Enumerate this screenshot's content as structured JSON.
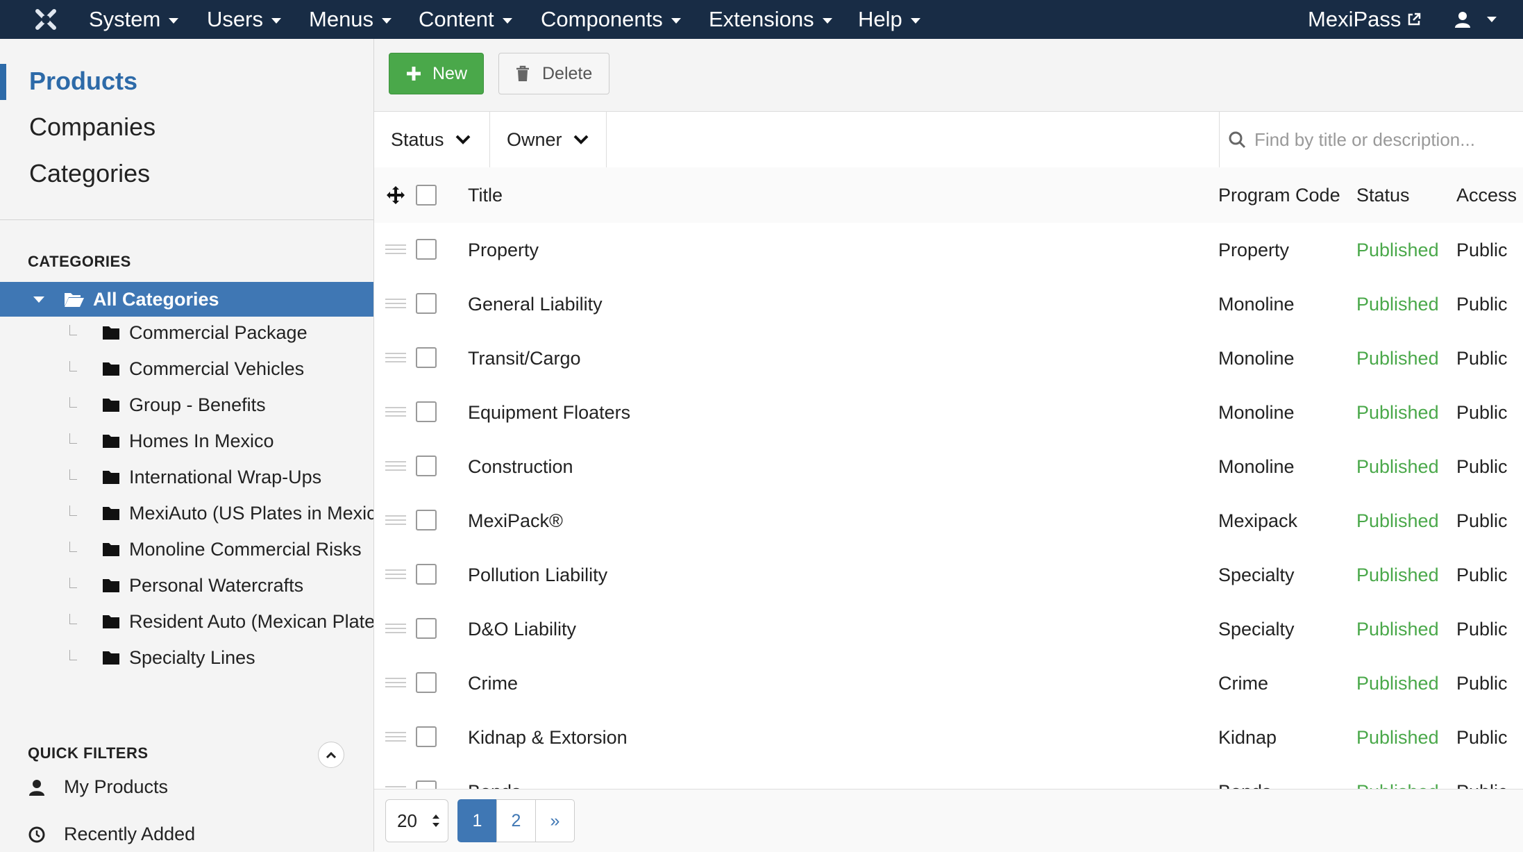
{
  "topbar": {
    "menus": [
      "System",
      "Users",
      "Menus",
      "Content",
      "Components",
      "Extensions",
      "Help"
    ],
    "site_link": "MexiPass",
    "icons": {
      "logo": "joomla-logo-icon",
      "external": "external-link-icon",
      "user": "user-icon"
    }
  },
  "sidebar": {
    "nav": [
      "Products",
      "Companies",
      "Categories"
    ],
    "categories_title": "CATEGORIES",
    "all_categories": "All Categories",
    "categories": [
      "Commercial Package",
      "Commercial Vehicles",
      "Group - Benefits",
      "Homes In Mexico",
      "International Wrap-Ups",
      "MexiAuto (US Plates in Mexico)",
      "Monoline Commercial Risks",
      "Personal Watercrafts",
      "Resident Auto (Mexican Plates)",
      "Specialty Lines"
    ],
    "quick_filters_title": "QUICK FILTERS",
    "quick_filters": [
      "My Products",
      "Recently Added"
    ]
  },
  "toolbar": {
    "new_label": "New",
    "delete_label": "Delete"
  },
  "filters": {
    "status_label": "Status",
    "owner_label": "Owner",
    "search_placeholder": "Find by title or description..."
  },
  "table": {
    "headers": {
      "title": "Title",
      "program_code": "Program Code",
      "status": "Status",
      "access": "Access"
    },
    "rows": [
      {
        "title": "Property",
        "code": "Property",
        "status": "Published",
        "access": "Public"
      },
      {
        "title": "General Liability",
        "code": "Monoline",
        "status": "Published",
        "access": "Public"
      },
      {
        "title": "Transit/Cargo",
        "code": "Monoline",
        "status": "Published",
        "access": "Public"
      },
      {
        "title": "Equipment Floaters",
        "code": "Monoline",
        "status": "Published",
        "access": "Public"
      },
      {
        "title": "Construction",
        "code": "Monoline",
        "status": "Published",
        "access": "Public"
      },
      {
        "title": "MexiPack®",
        "code": "Mexipack",
        "status": "Published",
        "access": "Public"
      },
      {
        "title": "Pollution Liability",
        "code": "Specialty",
        "status": "Published",
        "access": "Public"
      },
      {
        "title": "D&O Liability",
        "code": "Specialty",
        "status": "Published",
        "access": "Public"
      },
      {
        "title": "Crime",
        "code": "Crime",
        "status": "Published",
        "access": "Public"
      },
      {
        "title": "Kidnap & Extorsion",
        "code": "Kidnap",
        "status": "Published",
        "access": "Public"
      },
      {
        "title": "Bonds",
        "code": "Bonds",
        "status": "Published",
        "access": "Public"
      }
    ]
  },
  "pagination": {
    "limit": "20",
    "pages": [
      "1",
      "2"
    ],
    "next": "»",
    "current": "1"
  },
  "colors": {
    "topbar": "#182c45",
    "accent": "#3f77b4",
    "success": "#4aa84a"
  }
}
